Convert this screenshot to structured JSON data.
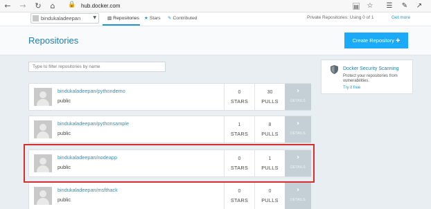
{
  "browser": {
    "url": "hub.docker.com",
    "icons": [
      "back-icon",
      "forward-icon",
      "refresh-icon",
      "home-icon",
      "lock-icon",
      "reading-view-icon",
      "favorite-star-icon",
      "hub-icon",
      "notes-icon",
      "share-icon"
    ]
  },
  "topnav": {
    "account": "bindukaladeepan",
    "tabs": [
      {
        "label": "Repositories",
        "icon": "book-icon"
      },
      {
        "label": "Stars",
        "icon": "star-icon"
      },
      {
        "label": "Contributed",
        "icon": "edit-icon"
      }
    ],
    "private_repos": "Private Repositories:  Using 0 of 1",
    "get_more": "Get more"
  },
  "header": {
    "title": "Repositories",
    "create_button": "Create Repository ✚"
  },
  "filter": {
    "placeholder": "Type to filter repositories by name"
  },
  "stat_labels": {
    "stars": "STARS",
    "pulls": "PULLS",
    "details": "DETAILS"
  },
  "repositories": [
    {
      "name": "bindukaladeepan/pythondemo",
      "visibility": "public",
      "stars": "0",
      "pulls": "30"
    },
    {
      "name": "bindukaladeepan/pythonsample",
      "visibility": "public",
      "stars": "1",
      "pulls": "8"
    },
    {
      "name": "bindukaladeepan/nodeapp",
      "visibility": "public",
      "stars": "0",
      "pulls": "1"
    },
    {
      "name": "bindukaladeepan/msfthack",
      "visibility": "public",
      "stars": "0",
      "pulls": "0"
    }
  ],
  "security": {
    "title": "Docker Security Scanning",
    "description": "Protect your repositories from vulnerabilities.",
    "link": "Try it free"
  },
  "colors": {
    "accent": "#1e96c6",
    "create_button": "#1aaaf8",
    "highlight": "#d92d2d",
    "details_bg": "#c5cfd6"
  }
}
